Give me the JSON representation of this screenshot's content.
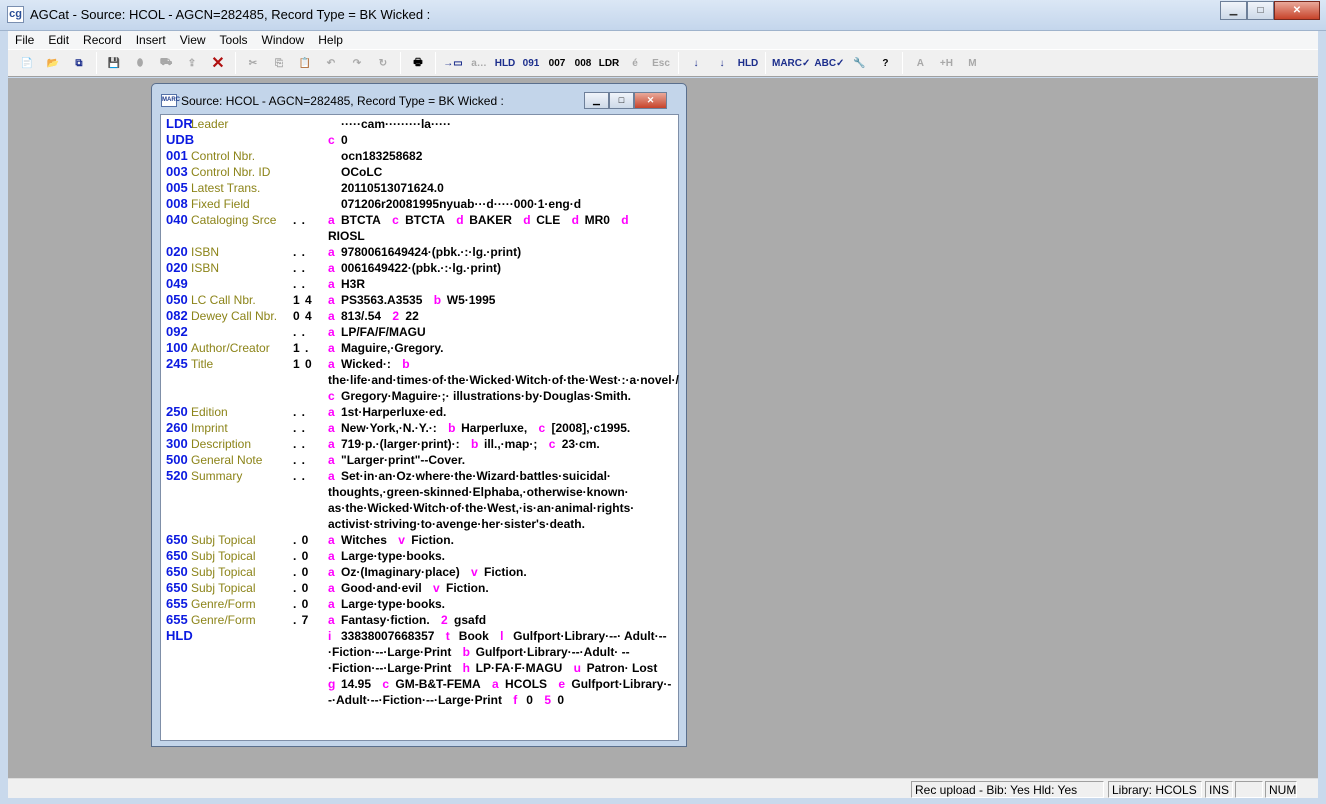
{
  "app": {
    "title": "AGCat - Source: HCOL - AGCN=282485,  Record Type = BK Wicked :",
    "icon": "agcat-logo-icon"
  },
  "window_controls": {
    "minimize": "▁",
    "maximize": "□",
    "close": "✕"
  },
  "menu": [
    "File",
    "Edit",
    "Record",
    "Insert",
    "View",
    "Tools",
    "Window",
    "Help"
  ],
  "toolbar": [
    {
      "name": "new-record",
      "glyph": "📄",
      "state": "enabled"
    },
    {
      "name": "open",
      "glyph": "📂",
      "state": "disabled"
    },
    {
      "name": "workflow",
      "glyph": "⧉",
      "state": "blue"
    },
    {
      "sep": true
    },
    {
      "name": "save",
      "glyph": "💾",
      "state": "disabled"
    },
    {
      "name": "database",
      "glyph": "⬮",
      "state": "disabled"
    },
    {
      "name": "cart-add",
      "glyph": "⛟",
      "state": "disabled"
    },
    {
      "name": "upload",
      "glyph": "⇪",
      "state": "disabled"
    },
    {
      "name": "delete",
      "glyph": "✕",
      "state": "red"
    },
    {
      "sep": true
    },
    {
      "name": "cut",
      "glyph": "✂",
      "state": "disabled"
    },
    {
      "name": "copy",
      "glyph": "⎘",
      "state": "disabled"
    },
    {
      "name": "paste",
      "glyph": "📋",
      "state": "disabled"
    },
    {
      "name": "undo",
      "glyph": "↶",
      "state": "disabled"
    },
    {
      "name": "redo",
      "glyph": "↷",
      "state": "disabled"
    },
    {
      "name": "repeat",
      "glyph": "↻",
      "state": "disabled"
    },
    {
      "sep": true
    },
    {
      "name": "print",
      "glyph": "🖶",
      "state": "enabled"
    },
    {
      "sep": true
    },
    {
      "name": "insert-field",
      "glyph": "→▭",
      "state": "blue"
    },
    {
      "name": "insert-subfield",
      "glyph": "a…",
      "state": "disabled"
    },
    {
      "name": "insert-hld",
      "glyph": "HLD",
      "state": "blue"
    },
    {
      "name": "insert-091",
      "glyph": "091",
      "state": "blue"
    },
    {
      "name": "field-007",
      "glyph": "007",
      "state": "enabled"
    },
    {
      "name": "field-008",
      "glyph": "008",
      "state": "enabled"
    },
    {
      "name": "leader",
      "glyph": "LDR",
      "state": "enabled"
    },
    {
      "name": "diacritic",
      "glyph": "é",
      "state": "disabled"
    },
    {
      "name": "escape",
      "glyph": "Esc",
      "state": "disabled"
    },
    {
      "sep": true
    },
    {
      "name": "sort-fields",
      "glyph": "↓",
      "state": "blue"
    },
    {
      "name": "sort-hld",
      "glyph": "↓",
      "state": "blue"
    },
    {
      "name": "hld-list",
      "glyph": "HLD",
      "state": "blue"
    },
    {
      "sep": true
    },
    {
      "name": "validate-marc",
      "glyph": "MARC✓",
      "state": "blue"
    },
    {
      "name": "spellcheck",
      "glyph": "ABC✓",
      "state": "blue"
    },
    {
      "name": "tools",
      "glyph": "🔧",
      "state": "enabled"
    },
    {
      "name": "help",
      "glyph": "?",
      "state": "enabled"
    },
    {
      "sep": true
    },
    {
      "name": "authority-a",
      "glyph": "A",
      "state": "disabled"
    },
    {
      "name": "authority-h",
      "glyph": "+H",
      "state": "disabled"
    },
    {
      "name": "authority-m",
      "glyph": "M",
      "state": "disabled"
    }
  ],
  "child": {
    "title": "Source: HCOL - AGCN=282485,  Record Type = BK Wicked :",
    "icon": "marc-record-icon"
  },
  "fields": [
    {
      "tag": "LDR",
      "label": "Leader",
      "ind": "",
      "sub": [
        {
          "c": "",
          "t": "·····cam·········la·····"
        }
      ]
    },
    {
      "tag": "UDB",
      "label": "",
      "ind": "",
      "sub": [
        {
          "c": "c",
          "t": "0"
        }
      ]
    },
    {
      "tag": "001",
      "label": "Control Nbr.",
      "ind": "",
      "sub": [
        {
          "c": "",
          "t": "ocn183258682"
        }
      ]
    },
    {
      "tag": "003",
      "label": "Control Nbr. ID",
      "ind": "",
      "sub": [
        {
          "c": "",
          "t": "OCoLC"
        }
      ]
    },
    {
      "tag": "005",
      "label": "Latest Trans.",
      "ind": "",
      "sub": [
        {
          "c": "",
          "t": "20110513071624.0"
        }
      ]
    },
    {
      "tag": "008",
      "label": "Fixed Field",
      "ind": "",
      "sub": [
        {
          "c": "",
          "t": "071206r20081995nyuab···d·····000·1·eng·d"
        }
      ]
    },
    {
      "tag": "040",
      "label": "Cataloging Srce",
      "ind": ". .",
      "sub": [
        {
          "c": "a",
          "t": "BTCTA"
        },
        {
          "c": "c",
          "t": "BTCTA"
        },
        {
          "c": "d",
          "t": "BAKER"
        },
        {
          "c": "d",
          "t": "CLE"
        },
        {
          "c": "d",
          "t": "MR0"
        },
        {
          "c": "d",
          "t": "RIOSL"
        }
      ]
    },
    {
      "tag": "020",
      "label": "ISBN",
      "ind": ". .",
      "sub": [
        {
          "c": "a",
          "t": "9780061649424·(pbk.·:·lg.·print)"
        }
      ]
    },
    {
      "tag": "020",
      "label": "ISBN",
      "ind": ". .",
      "sub": [
        {
          "c": "a",
          "t": "0061649422·(pbk.·:·lg.·print)"
        }
      ]
    },
    {
      "tag": "049",
      "label": "",
      "ind": ". .",
      "sub": [
        {
          "c": "a",
          "t": "H3R"
        }
      ]
    },
    {
      "tag": "050",
      "label": "LC Call Nbr.",
      "ind": "1 4",
      "sub": [
        {
          "c": "a",
          "t": "PS3563.A3535"
        },
        {
          "c": "b",
          "t": "W5·1995"
        }
      ]
    },
    {
      "tag": "082",
      "label": "Dewey Call Nbr.",
      "ind": "0 4",
      "sub": [
        {
          "c": "a",
          "t": "813/.54"
        },
        {
          "c": "2",
          "t": "22"
        }
      ]
    },
    {
      "tag": "092",
      "label": "",
      "ind": ". .",
      "sub": [
        {
          "c": "a",
          "t": "LP/FA/F/MAGU"
        }
      ]
    },
    {
      "tag": "100",
      "label": "Author/Creator",
      "ind": "1 .",
      "sub": [
        {
          "c": "a",
          "t": "Maguire,·Gregory."
        }
      ]
    },
    {
      "tag": "245",
      "label": "Title",
      "ind": "1 0",
      "sub": [
        {
          "c": "a",
          "t": "Wicked·:"
        },
        {
          "c": "b",
          "t": "the·life·and·times·of·the·Wicked·Witch·of·the·West·:·a·novel·/"
        },
        {
          "c": "c",
          "t": "Gregory·Maguire·;· illustrations·by·Douglas·Smith."
        }
      ]
    },
    {
      "tag": "250",
      "label": "Edition",
      "ind": ". .",
      "sub": [
        {
          "c": "a",
          "t": "1st·Harperluxe·ed."
        }
      ]
    },
    {
      "tag": "260",
      "label": "Imprint",
      "ind": ". .",
      "sub": [
        {
          "c": "a",
          "t": "New·York,·N.·Y.·:"
        },
        {
          "c": "b",
          "t": "Harperluxe,"
        },
        {
          "c": "c",
          "t": "[2008],·c1995."
        }
      ]
    },
    {
      "tag": "300",
      "label": "Description",
      "ind": ". .",
      "sub": [
        {
          "c": "a",
          "t": "719·p.·(larger·print)·:"
        },
        {
          "c": "b",
          "t": "ill.,·map·;"
        },
        {
          "c": "c",
          "t": "23·cm."
        }
      ]
    },
    {
      "tag": "500",
      "label": "General Note",
      "ind": ". .",
      "sub": [
        {
          "c": "a",
          "t": "\"Larger·print\"--Cover."
        }
      ]
    },
    {
      "tag": "520",
      "label": "Summary",
      "ind": ". .",
      "sub": [
        {
          "c": "a",
          "t": "Set·in·an·Oz·where·the·Wizard·battles·suicidal· thoughts,·green-skinned·Elphaba,·otherwise·known· as·the·Wicked·Witch·of·the·West,·is·an·animal·rights· activist·striving·to·avenge·her·sister's·death."
        }
      ]
    },
    {
      "tag": "650",
      "label": "Subj Topical",
      "ind": ". 0",
      "sub": [
        {
          "c": "a",
          "t": "Witches"
        },
        {
          "c": "v",
          "t": "Fiction."
        }
      ]
    },
    {
      "tag": "650",
      "label": "Subj Topical",
      "ind": ". 0",
      "sub": [
        {
          "c": "a",
          "t": "Large·type·books."
        }
      ]
    },
    {
      "tag": "650",
      "label": "Subj Topical",
      "ind": ". 0",
      "sub": [
        {
          "c": "a",
          "t": "Oz·(Imaginary·place)"
        },
        {
          "c": "v",
          "t": "Fiction."
        }
      ]
    },
    {
      "tag": "650",
      "label": "Subj Topical",
      "ind": ". 0",
      "sub": [
        {
          "c": "a",
          "t": "Good·and·evil"
        },
        {
          "c": "v",
          "t": "Fiction."
        }
      ]
    },
    {
      "tag": "655",
      "label": "Genre/Form",
      "ind": ". 0",
      "sub": [
        {
          "c": "a",
          "t": "Large·type·books."
        }
      ]
    },
    {
      "tag": "655",
      "label": "Genre/Form",
      "ind": ". 7",
      "sub": [
        {
          "c": "a",
          "t": "Fantasy·fiction."
        },
        {
          "c": "2",
          "t": "gsafd"
        }
      ]
    },
    {
      "tag": "HLD",
      "label": "",
      "ind": "",
      "sub": [
        {
          "c": "i",
          "t": "33838007668357"
        },
        {
          "c": "t",
          "t": "Book"
        },
        {
          "c": "l",
          "t": "Gulfport·Library·--· Adult·--·Fiction·--·Large·Print"
        },
        {
          "c": "b",
          "t": "Gulfport·Library·--·Adult· --·Fiction·--·Large·Print"
        },
        {
          "c": "h",
          "t": "LP·FA·F·MAGU"
        },
        {
          "c": "u",
          "t": "Patron· Lost"
        },
        {
          "c": "g",
          "t": "14.95"
        },
        {
          "c": "c",
          "t": "GM-B&T-FEMA"
        },
        {
          "c": "a",
          "t": "HCOLS"
        },
        {
          "c": "e",
          "t": "Gulfport·Library·--·Adult·--·Fiction·--·Large·Print"
        },
        {
          "c": "f",
          "t": "0"
        },
        {
          "c": "5",
          "t": "0"
        }
      ]
    }
  ],
  "status": {
    "upload": "Rec upload - Bib: Yes  Hld: Yes",
    "library": "Library: HCOLS",
    "ins": "INS",
    "blank": "",
    "num": "NUM"
  },
  "colors": {
    "tag": "#0b1ae0",
    "label": "#8c8419",
    "subfield_code": "#ff00ff",
    "mdi_background": "#ababab"
  }
}
